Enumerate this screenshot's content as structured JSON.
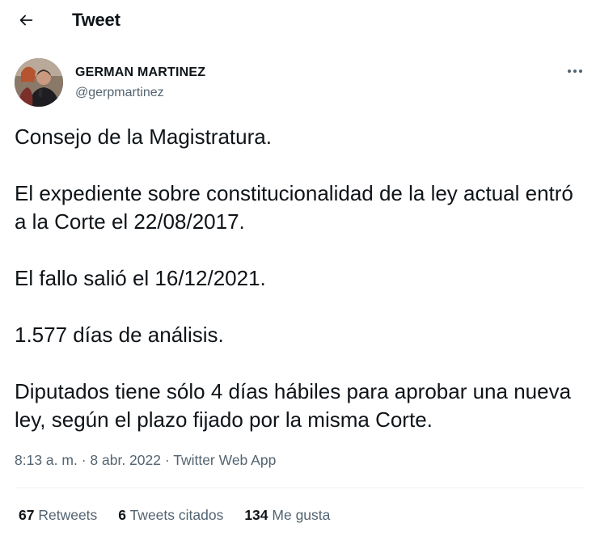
{
  "header": {
    "title": "Tweet",
    "back_icon": "arrow-left-icon"
  },
  "author": {
    "display_name": "GERMAN MARTINEZ",
    "handle": "@gerpmartinez",
    "more_icon": "more-horizontal-icon"
  },
  "tweet": {
    "paragraphs": [
      "Consejo de la Magistratura.",
      "El expediente sobre constitucionalidad de la ley actual entró a la Corte el 22/08/2017.",
      "El fallo salió el 16/12/2021.",
      "1.577 días de análisis.",
      "Diputados tiene sólo 4 días hábiles para aprobar una nueva ley, según el plazo fijado por la misma Corte."
    ]
  },
  "meta": {
    "time": "8:13 a. m.",
    "separator": " · ",
    "date": "8 abr. 2022",
    "source": "Twitter Web App"
  },
  "stats": {
    "retweets": {
      "count": "67",
      "label": "Retweets"
    },
    "quotes": {
      "count": "6",
      "label": "Tweets citados"
    },
    "likes": {
      "count": "134",
      "label": "Me gusta"
    }
  },
  "colors": {
    "text_primary": "#0f1419",
    "text_secondary": "#536471",
    "divider": "#eff3f4"
  }
}
